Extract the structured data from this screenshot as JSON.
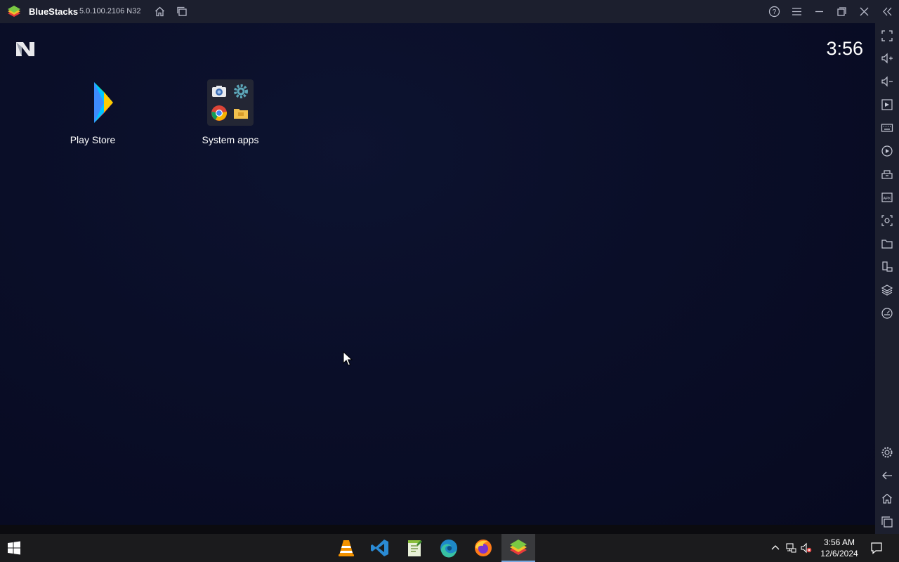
{
  "window": {
    "app_name": "BlueStacks",
    "version": "5.0.100.2106 N32"
  },
  "titlebar": {
    "icons": [
      "home-icon",
      "multi-instance-icon",
      "help-icon",
      "menu-icon",
      "minimize-icon",
      "restore-icon",
      "close-icon",
      "collapse-sidebar-icon"
    ]
  },
  "android": {
    "clock": "3:56",
    "apps": [
      {
        "label": "Play Store",
        "icon": "play-store-icon"
      },
      {
        "label": "System apps",
        "icon": "system-apps-folder-icon"
      }
    ]
  },
  "sidebar": {
    "top_items": [
      "fullscreen-icon",
      "volume-up-icon",
      "volume-down-icon",
      "media-manager-icon",
      "keyboard-controls-icon",
      "macro-icon",
      "multi-instance-manager-icon",
      "install-apk-icon",
      "screenshot-icon",
      "folder-icon",
      "rotate-icon",
      "layers-icon",
      "eco-mode-icon"
    ],
    "bottom_items": [
      "settings-icon",
      "back-icon",
      "android-home-icon",
      "recent-apps-icon"
    ]
  },
  "taskbar": {
    "apps": [
      "vlc-icon",
      "vscode-icon",
      "notepad-plus-icon",
      "edge-icon",
      "firefox-icon",
      "bluestacks-icon"
    ],
    "active_app": "bluestacks-icon",
    "time": "3:56 AM",
    "date": "12/6/2024"
  },
  "colors": {
    "titlebar_bg": "#1c1f2e",
    "screen_bg": "#0a0e28",
    "taskbar_bg": "#1b1b1d",
    "taskbar_accent": "#7aa9e0"
  }
}
